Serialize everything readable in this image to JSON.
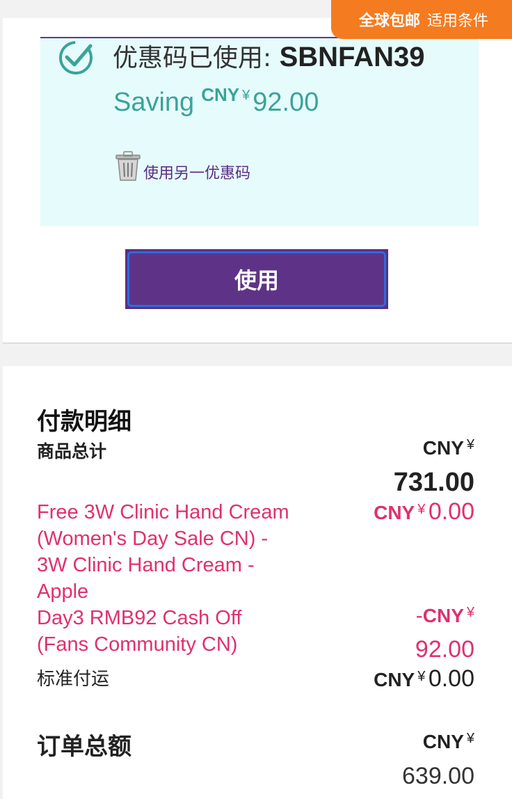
{
  "badge": {
    "bold": "全球包邮",
    "link": "适用条件"
  },
  "coupon": {
    "label": "优惠码已使用: ",
    "code": "SBNFAN39",
    "saving_word": "Saving",
    "saving_currency": "CNY",
    "saving_yen": "¥",
    "saving_amount": "92.00",
    "remove_label": "使用另一优惠码"
  },
  "apply_button": "使用",
  "payment": {
    "heading": "付款明细",
    "subtotal": {
      "label": "商品总计",
      "currency": "CNY",
      "yen": "¥",
      "amount": "731.00"
    },
    "gift": {
      "lines": [
        "Free 3W Clinic Hand Cream",
        "(Women's Day Sale CN) -",
        "3W Clinic Hand Cream -",
        "Apple"
      ],
      "currency": "CNY",
      "yen": "¥",
      "amount": "0.00"
    },
    "discount": {
      "lines": [
        "Day3 RMB92 Cash Off",
        "(Fans Community CN)"
      ],
      "sign": "-",
      "currency": "CNY",
      "yen": "¥",
      "amount": "92.00"
    },
    "shipping": {
      "label": "标准付运",
      "currency": "CNY",
      "yen": "¥",
      "amount": "0.00"
    },
    "total": {
      "label": "订单总额",
      "currency": "CNY",
      "yen": "¥",
      "amount": "639.00"
    }
  },
  "colors": {
    "accent": "#5b2d86",
    "teal": "#3aa39a",
    "pink": "#e1306c",
    "orange": "#f47b20"
  }
}
